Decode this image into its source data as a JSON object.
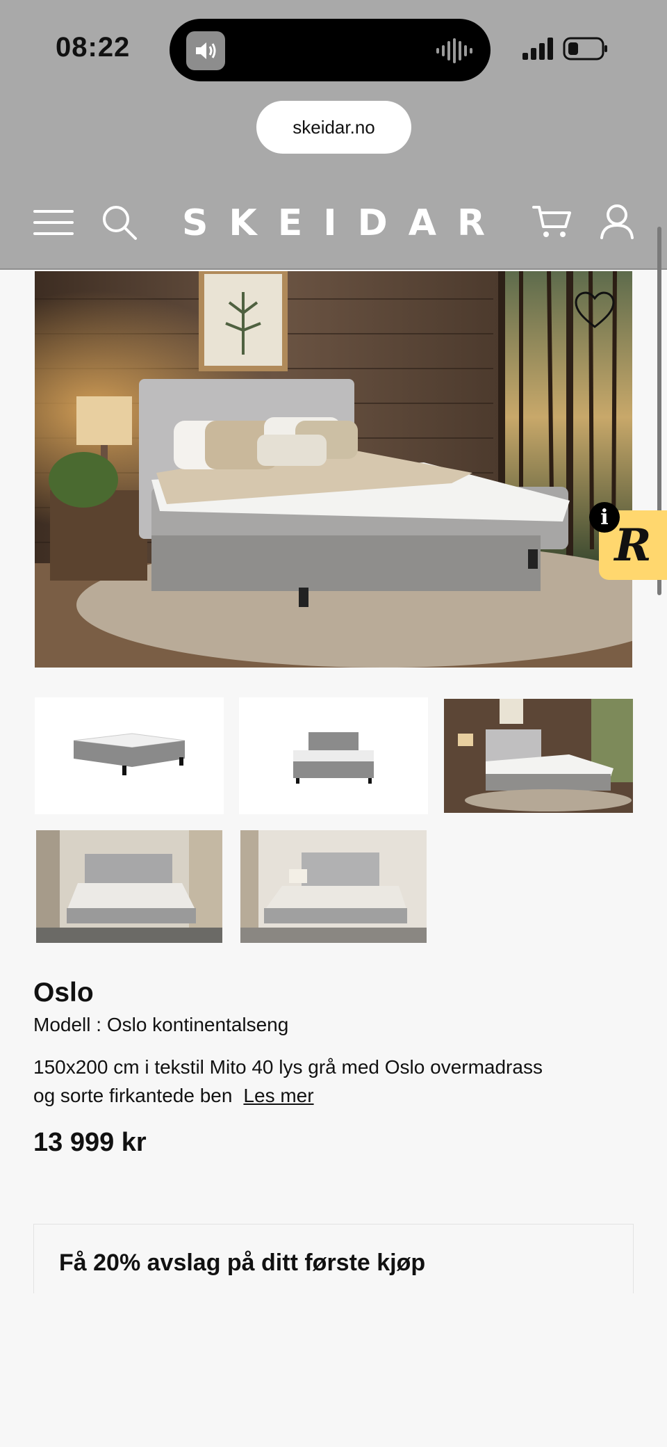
{
  "status_bar": {
    "time": "08:22",
    "icons": [
      "speaker-icon",
      "waveform-icon",
      "signal-icon",
      "battery-icon"
    ]
  },
  "browser": {
    "url": "skeidar.no"
  },
  "header": {
    "logo": "SKEIDAR",
    "icons": [
      "hamburger-icon",
      "search-icon",
      "cart-icon",
      "account-icon"
    ]
  },
  "gallery": {
    "main_image_alt": "Oslo kontinentalseng bedroom scene",
    "thumbnails": 5
  },
  "badges": {
    "review_letter": "R",
    "info_letter": "i"
  },
  "product": {
    "title": "Oslo",
    "model": "Modell : Oslo kontinentalseng",
    "description": "150x200 cm i tekstil Mito 40 lys grå med Oslo overmadrass og sorte firkantede ben",
    "read_more": "Les mer",
    "price": "13 999 kr"
  },
  "promo": {
    "title": "Få 20% avslag på ditt første kjøp"
  },
  "colors": {
    "overlay": "#a9a9a9",
    "page_bg": "#f7f7f7",
    "review_badge": "#ffd76e",
    "text": "#111111"
  }
}
